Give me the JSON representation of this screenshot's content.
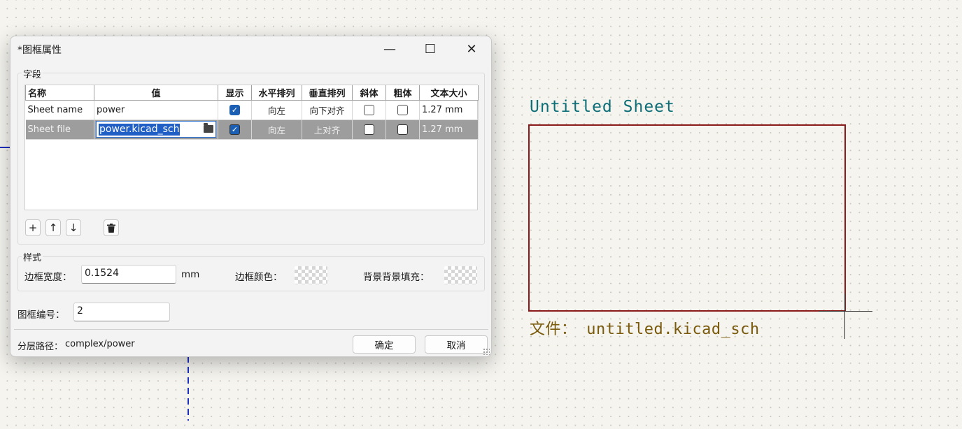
{
  "canvas": {
    "sheet_name_text": "Untitled Sheet",
    "sheet_file_text": "文件： untitled.kicad_sch",
    "colors": {
      "sheet_border": "#8a1a1a",
      "sheet_name": "#0e6e78",
      "sheet_file": "#7a5a0c",
      "wire_blue": "#1c2fbf"
    }
  },
  "dialog": {
    "title": "*图框属性",
    "titlebar": {
      "minimize_icon": "minimize-icon",
      "maximize_icon": "maximize-icon",
      "close_icon": "close-icon"
    },
    "fields": {
      "legend": "字段",
      "columns": [
        "名称",
        "值",
        "显示",
        "水平排列",
        "垂直排列",
        "斜体",
        "粗体",
        "文本大小"
      ],
      "rows": [
        {
          "name": "Sheet name",
          "value": "power",
          "show": true,
          "h_align": "向左",
          "v_align": "向下对齐",
          "italic": false,
          "bold": false,
          "text_size": "1.27 mm",
          "selected": false
        },
        {
          "name": "Sheet file",
          "value": "power.kicad_sch",
          "show": true,
          "h_align": "向左",
          "v_align": "上对齐",
          "italic": false,
          "bold": false,
          "text_size": "1.27 mm",
          "selected": true
        }
      ],
      "toolbar_icons": [
        "plus-icon",
        "arrow-up-icon",
        "arrow-down-icon",
        "trash-icon"
      ]
    },
    "style": {
      "legend": "样式",
      "border_width_label": "边框宽度：",
      "border_width_value": "0.1524",
      "border_width_unit": "mm",
      "border_color_label": "边框颜色：",
      "background_fill_label": "背景背景填充："
    },
    "sheet_number_label": "图框编号：",
    "sheet_number_value": "2",
    "hierarchy_path_label": "分层路径：",
    "hierarchy_path_value": "complex/power",
    "ok_label": "确定",
    "cancel_label": "取消",
    "accent_color": "#1a5fb4"
  }
}
